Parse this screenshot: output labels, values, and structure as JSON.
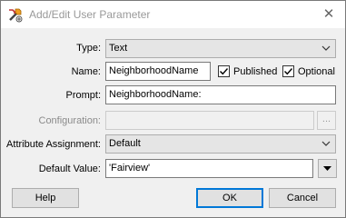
{
  "window": {
    "title": "Add/Edit User Parameter"
  },
  "form": {
    "type": {
      "label": "Type:",
      "value": "Text"
    },
    "name": {
      "label": "Name:",
      "value": "NeighborhoodName"
    },
    "published": {
      "label": "Published",
      "checked": true
    },
    "optional": {
      "label": "Optional",
      "checked": true
    },
    "prompt": {
      "label": "Prompt:",
      "value": "NeighborhoodName:"
    },
    "configuration": {
      "label": "Configuration:",
      "value": "",
      "button_label": "..."
    },
    "attribute_assignment": {
      "label": "Attribute Assignment:",
      "value": "Default"
    },
    "default_value": {
      "label": "Default Value:",
      "value": "'Fairview'"
    }
  },
  "buttons": {
    "help": "Help",
    "ok": "OK",
    "cancel": "Cancel"
  },
  "icons": {
    "app": "fme-parameter-icon",
    "close": "close-icon",
    "chevron": "chevron-down-icon",
    "dropdown": "triangle-down-icon"
  }
}
